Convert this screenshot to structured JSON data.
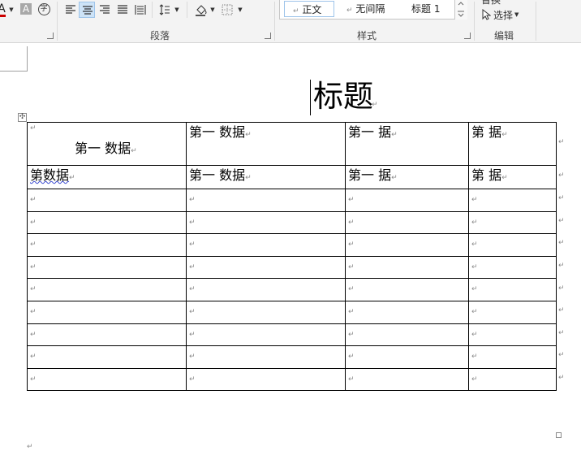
{
  "ribbon": {
    "paragraph_group_label": "段落",
    "styles_group_label": "样式",
    "editing_group_label": "编辑",
    "styles": [
      {
        "label": "正文",
        "mark": "↵"
      },
      {
        "label": "无间隔",
        "mark": "↵"
      },
      {
        "label": "标题 1",
        "mark": ""
      }
    ],
    "select_label": "选择",
    "font_color_letter": "A",
    "highlight_letter": "A",
    "phonetic_char": "字",
    "replace_partial": "替换",
    "accent_color": "#cc0000",
    "selected_align": "center"
  },
  "document": {
    "title": "标题",
    "para_mark": "↵",
    "table": {
      "rows": [
        [
          "第一 数据",
          "第一 数据",
          "第一 据",
          "第 据"
        ],
        [
          "第数据",
          "第一 数据",
          "第一 据",
          "第 据"
        ],
        [
          "",
          "",
          "",
          ""
        ],
        [
          "",
          "",
          "",
          ""
        ],
        [
          "",
          "",
          "",
          ""
        ],
        [
          "",
          "",
          "",
          ""
        ],
        [
          "",
          "",
          "",
          ""
        ],
        [
          "",
          "",
          "",
          ""
        ],
        [
          "",
          "",
          "",
          ""
        ],
        [
          "",
          "",
          "",
          ""
        ],
        [
          "",
          "",
          "",
          ""
        ]
      ]
    },
    "move_handle_glyph": "✣"
  }
}
